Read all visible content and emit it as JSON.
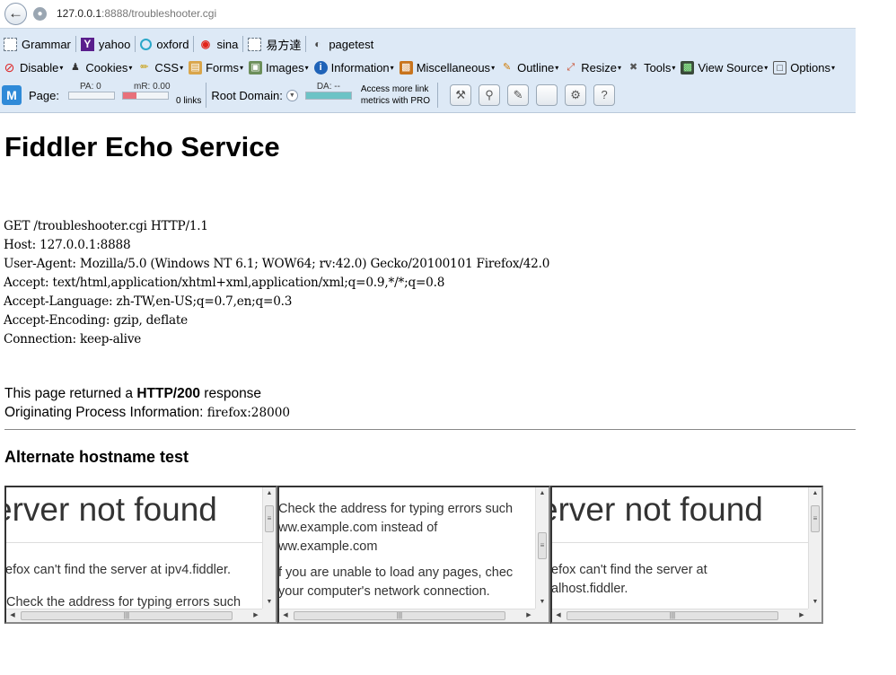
{
  "browser": {
    "url_host": "127.0.0.1",
    "url_rest": ":8888/troubleshooter.cgi",
    "back_icon": "back-arrow-icon",
    "site_icon": "globe-icon"
  },
  "bookmarks": [
    {
      "label": "Grammar",
      "icon": "dashed-box-icon"
    },
    {
      "label": "yahoo",
      "icon": "yahoo-icon"
    },
    {
      "label": "oxford",
      "icon": "oxford-icon"
    },
    {
      "label": "sina",
      "icon": "sina-icon"
    },
    {
      "label": "易方達",
      "icon": "dashed-box-icon"
    },
    {
      "label": "pagetest",
      "icon": "gauge-icon"
    }
  ],
  "webdev": {
    "disable": "Disable",
    "cookies": "Cookies",
    "css": "CSS",
    "forms": "Forms",
    "images": "Images",
    "information": "Information",
    "miscellaneous": "Miscellaneous",
    "outline": "Outline",
    "resize": "Resize",
    "tools": "Tools",
    "view_source": "View Source",
    "options": "Options"
  },
  "moz": {
    "page_label": "Page:",
    "pa": "PA: 0",
    "mr": "mR: 0.00",
    "mr_fill": 0.3,
    "links": "0 links",
    "root_domain": "Root Domain:",
    "da": "DA: --",
    "da_fill": 1.0,
    "pro_line1": "Access more link",
    "pro_line2": "metrics with PRO"
  },
  "page": {
    "title": "Fiddler Echo Service",
    "request_lines": [
      "GET /troubleshooter.cgi HTTP/1.1",
      "Host: 127.0.0.1:8888",
      "User-Agent: Mozilla/5.0 (Windows NT 6.1; WOW64; rv:42.0) Gecko/20100101 Firefox/42.0",
      "Accept: text/html,application/xhtml+xml,application/xml;q=0.9,*/*;q=0.8",
      "Accept-Language: zh-TW,en-US;q=0.7,en;q=0.3",
      "Accept-Encoding: gzip, deflate",
      "Connection: keep-alive"
    ],
    "resp_prefix": "This page returned a ",
    "resp_status": "HTTP/200",
    "resp_suffix": " response",
    "process_label": "Originating Process Information: ",
    "process_value": "firefox:28000",
    "alt_heading": "Alternate hostname test"
  },
  "frames": [
    {
      "big": "erver not found",
      "line1": "efox can't find the server at ipv4.fiddler.",
      "line2": "Check the address for typing errors such"
    },
    {
      "line1": "Check the address for typing errors such",
      "line2": "ww.example.com instead of",
      "line3": "ww.example.com",
      "line4": "f you are unable to load any pages, chec",
      "line5": "your computer's network connection."
    },
    {
      "big": "erver not found",
      "line1": "efox can't find the server at",
      "line2": "alhost.fiddler."
    }
  ]
}
